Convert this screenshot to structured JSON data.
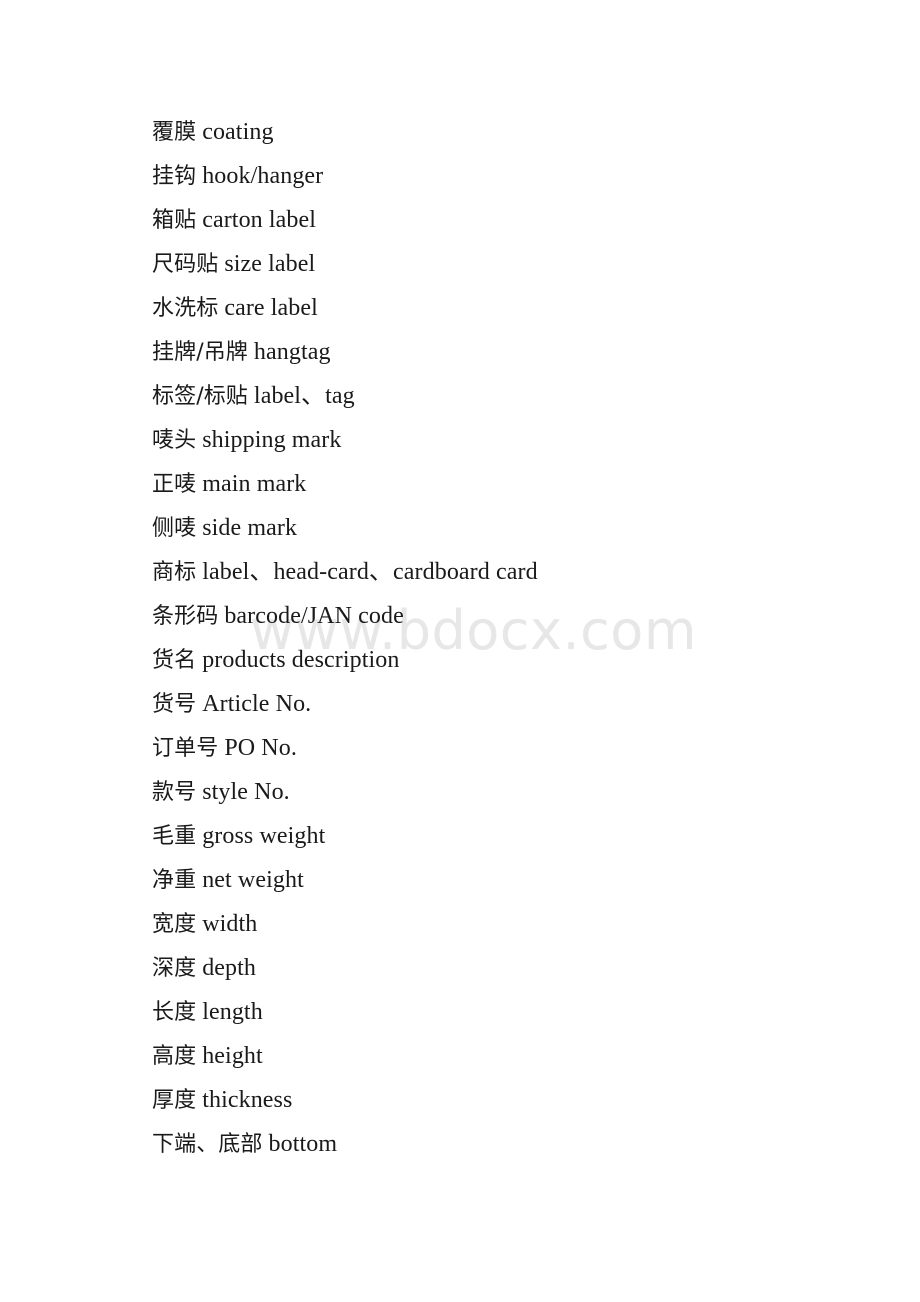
{
  "page": {
    "background_color": "#ffffff",
    "text_color": "#1a1a1a",
    "kind": "document-page",
    "document_type": "chinese-english-glossary",
    "subject": "garment packaging and shipping terms"
  },
  "watermark": {
    "text": "www.bdocx.com",
    "color": "#e7e7e7"
  },
  "glossary": {
    "entries": [
      {
        "cn": "覆膜",
        "en": "coating"
      },
      {
        "cn": "挂钩",
        "en": "hook/hanger"
      },
      {
        "cn": "箱贴",
        "en": "carton label"
      },
      {
        "cn": "尺码贴",
        "en": "size label"
      },
      {
        "cn": "水洗标",
        "en": "care label"
      },
      {
        "cn": "挂牌/吊牌",
        "en": "hangtag"
      },
      {
        "cn": "标签/标贴",
        "en": "label、tag"
      },
      {
        "cn": "唛头",
        "en": "shipping mark"
      },
      {
        "cn": "正唛",
        "en": "main mark"
      },
      {
        "cn": "侧唛",
        "en": "side mark"
      },
      {
        "cn": "商标",
        "en": "label、head-card、cardboard card"
      },
      {
        "cn": "条形码",
        "en": "barcode/JAN code"
      },
      {
        "cn": "货名",
        "en": "products description"
      },
      {
        "cn": "货号",
        "en": "Article No."
      },
      {
        "cn": "订单号",
        "en": "PO No."
      },
      {
        "cn": "款号",
        "en": "style No."
      },
      {
        "cn": "毛重",
        "en": "gross weight"
      },
      {
        "cn": "净重",
        "en": "net weight"
      },
      {
        "cn": "宽度",
        "en": "width"
      },
      {
        "cn": "深度",
        "en": "depth"
      },
      {
        "cn": "长度",
        "en": "length"
      },
      {
        "cn": "高度",
        "en": "height"
      },
      {
        "cn": "厚度",
        "en": "thickness"
      },
      {
        "cn": "下端、底部",
        "en": "bottom"
      }
    ]
  }
}
